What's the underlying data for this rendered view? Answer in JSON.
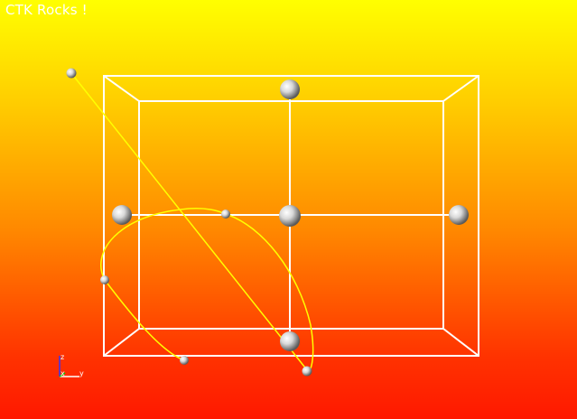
{
  "window": {
    "title": "CTK Rocks !"
  },
  "axes": {
    "z_label": "z",
    "x_label": "x",
    "y_label": "y"
  },
  "colors": {
    "background_top": "#ffff00",
    "background_bottom": "#ff1800",
    "box": "#ffffff",
    "spline": "#ffff00",
    "axis_z": "#3333ff",
    "axis_x": "#ffffff",
    "axis_y": "#00cc00"
  },
  "icons": {
    "handle": "sphere-handle-icon",
    "axes": "orientation-axes-icon"
  }
}
